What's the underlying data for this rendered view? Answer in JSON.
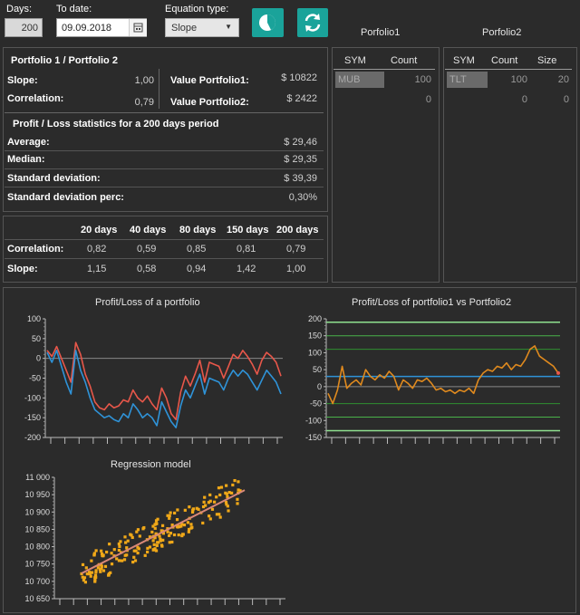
{
  "toolbar": {
    "days_label": "Days:",
    "days_value": "200",
    "todate_label": "To date:",
    "todate_value": "09.09.2018",
    "equation_label": "Equation type:",
    "equation_value": "Slope"
  },
  "stats": {
    "header": "Portfolio 1 / Portfolio 2",
    "slope_label": "Slope:",
    "slope_value": "1,00",
    "correlation_label": "Correlation:",
    "correlation_value": "0,79",
    "value_p1_label": "Value Portfolio1:",
    "value_p1": "$ 10822",
    "value_p2_label": "Value Portfolio2:",
    "value_p2": "$ 2422",
    "pl_header": "Profit / Loss statistics for a 200 days period",
    "average_label": "Average:",
    "average_value": "$ 29,46",
    "median_label": "Median:",
    "median_value": "$ 29,35",
    "std_label": "Standard deviation:",
    "std_value": "$ 39,39",
    "stdperc_label": "Standard deviation perc:",
    "stdperc_value": "0,30%"
  },
  "periods": {
    "headers": [
      "20 days",
      "40 days",
      "80 days",
      "150 days",
      "200 days"
    ],
    "rows": [
      {
        "label": "Correlation:",
        "values": [
          "0,82",
          "0,59",
          "0,85",
          "0,81",
          "0,79"
        ]
      },
      {
        "label": "Slope:",
        "values": [
          "1,15",
          "0,58",
          "0,94",
          "1,42",
          "1,00"
        ]
      }
    ]
  },
  "portfolio1": {
    "title": "Porfolio1",
    "columns": [
      "SYM",
      "Count"
    ],
    "rows": [
      [
        "MUB",
        "100"
      ],
      [
        "",
        "0"
      ]
    ]
  },
  "portfolio2": {
    "title": "Porfolio2",
    "columns": [
      "SYM",
      "Count",
      "Size"
    ],
    "rows": [
      [
        "TLT",
        "100",
        "20"
      ],
      [
        "",
        "0",
        "0"
      ]
    ]
  },
  "colors": {
    "teal": "#1aa39a",
    "series_red": "#e8574a",
    "series_blue": "#2f93d8",
    "series_orange": "#e08a1e",
    "regression_points": "#f0a818",
    "regression_line": "#d98878"
  },
  "chart_data": [
    {
      "type": "line",
      "title": "Profit/Loss of a portfolio",
      "ylim": [
        -200,
        100
      ],
      "yticks": [
        "100",
        "50",
        "0",
        "-50",
        "-100",
        "-150",
        "-200"
      ],
      "series": [
        {
          "values": [
            20,
            5,
            30,
            0,
            -30,
            -60,
            40,
            10,
            -40,
            -70,
            -110,
            -125,
            -130,
            -115,
            -125,
            -120,
            -105,
            -110,
            -80,
            -100,
            -110,
            -95,
            -115,
            -130,
            -75,
            -100,
            -140,
            -155,
            -85,
            -45,
            -70,
            -40,
            -5,
            -60,
            -10,
            -15,
            -20,
            -50,
            -20,
            10,
            0,
            20,
            5,
            -15,
            -40,
            -5,
            15,
            5,
            -10,
            -45
          ]
        },
        {
          "values": [
            15,
            -10,
            20,
            -20,
            -60,
            -90,
            20,
            -30,
            -60,
            -100,
            -130,
            -140,
            -150,
            -145,
            -155,
            -160,
            -140,
            -150,
            -115,
            -130,
            -150,
            -140,
            -150,
            -170,
            -110,
            -135,
            -160,
            -175,
            -120,
            -80,
            -100,
            -70,
            -40,
            -90,
            -50,
            -55,
            -60,
            -80,
            -50,
            -30,
            -45,
            -30,
            -40,
            -60,
            -80,
            -55,
            -30,
            -45,
            -60,
            -90
          ]
        }
      ]
    },
    {
      "type": "line",
      "title": "Profit/Loss of portfolio1 vs Portfolio2",
      "ylim": [
        -150,
        200
      ],
      "yticks": [
        "200",
        "150",
        "100",
        "50",
        "0",
        "-50",
        "-100",
        "-150"
      ],
      "series": [
        {
          "values": [
            -20,
            -50,
            -10,
            60,
            -5,
            10,
            20,
            5,
            50,
            30,
            20,
            35,
            25,
            45,
            30,
            -10,
            20,
            10,
            -5,
            20,
            15,
            25,
            10,
            -10,
            -5,
            -15,
            -10,
            -20,
            -10,
            -15,
            -5,
            -20,
            20,
            40,
            50,
            45,
            60,
            55,
            70,
            50,
            65,
            60,
            80,
            110,
            120,
            90,
            80,
            70,
            60,
            40
          ]
        }
      ]
    },
    {
      "type": "scatter",
      "title": "Regression model",
      "ylim": [
        10650,
        11000
      ],
      "yticks": [
        "11 000",
        "10 950",
        "10 900",
        "10 850",
        "10 800",
        "10 750",
        "10 700",
        "10 650"
      ],
      "trend": [
        [
          0,
          10723
        ],
        [
          1,
          10963
        ]
      ]
    }
  ]
}
